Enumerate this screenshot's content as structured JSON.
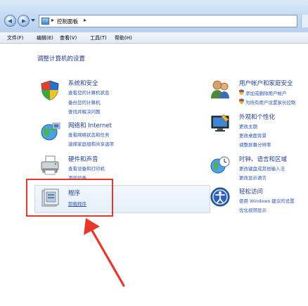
{
  "address": {
    "path": "控制面板",
    "sep": "▸"
  },
  "menu": [
    "文件(F)",
    "编辑(E)",
    "查看(V)",
    "工具(T)",
    "帮助(H)"
  ],
  "heading": "调整计算机的设置",
  "categories": {
    "system": {
      "title": "系统和安全",
      "links": [
        "查看您的计算机状态",
        "备份您的计算机",
        "查找并解决问题"
      ]
    },
    "network": {
      "title": "网络和 Internet",
      "links": [
        "查看网络状态和任务",
        "选择家庭组和共享选项"
      ]
    },
    "hardware": {
      "title": "硬件和声音",
      "links": [
        "查看设备和打印机",
        "添加设备"
      ]
    },
    "programs": {
      "title": "程序",
      "links": [
        "卸载程序"
      ]
    },
    "users": {
      "title": "用户帐户和家庭安全",
      "links": [
        "添加或删除用户帐户",
        "为所有用户设置家长控制"
      ]
    },
    "appearance": {
      "title": "外观和个性化",
      "links": [
        "更改主题",
        "更改桌面背景",
        "调整屏幕分辨率"
      ]
    },
    "clock": {
      "title": "时钟、语言和区域",
      "links": [
        "更改键盘或其他输入法",
        "更改显示语言"
      ]
    },
    "ease": {
      "title": "轻松访问",
      "links": [
        "使用 Windows 建议的设置",
        "优化视频显示"
      ]
    }
  },
  "colors": {
    "annotation": "#e8362d",
    "link": "#2b55b8",
    "title": "#1e3f96"
  }
}
